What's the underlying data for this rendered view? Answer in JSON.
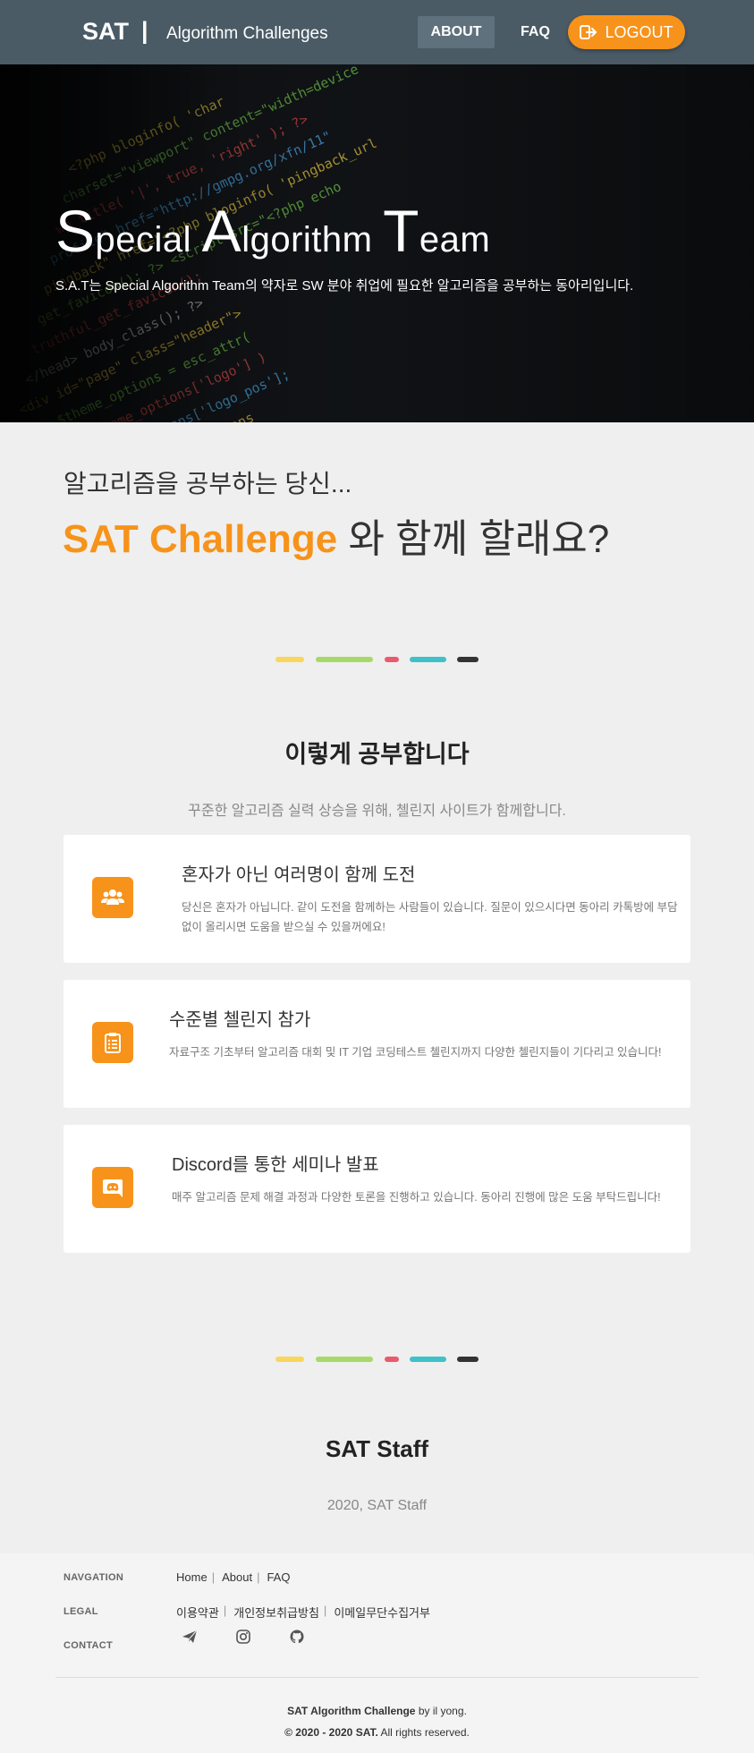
{
  "nav": {
    "brand": "SAT",
    "separator": "|",
    "subtitle": "Algorithm Challenges",
    "about": "ABOUT",
    "faq": "FAQ",
    "logout": "LOGOUT"
  },
  "hero": {
    "title_parts": [
      {
        "cap": "S",
        "rest": "pecial"
      },
      {
        "cap": "A",
        "rest": "lgorithm"
      },
      {
        "cap": "T",
        "rest": "eam"
      }
    ],
    "description": "S.A.T는 Special Algorithm Team의 약자로 SW 분야 취업에 필요한 알고리즘을 공부하는 동아리입니다."
  },
  "intro": {
    "line1": "알고리즘을 공부하는 당신...",
    "accent": "SAT Challenge",
    "line2_rest": " 와 함께 할래요?"
  },
  "divider_colors": [
    "#f9d65c",
    "#a6d96a",
    "#ea5a6f",
    "#3fc1c9",
    "#333333"
  ],
  "study": {
    "title": "이렇게 공부합니다",
    "subtitle": "꾸준한 알고리즘 실력 상승을 위해, 첼린지 사이트가 함께합니다.",
    "cards": [
      {
        "icon": "users-icon",
        "title": "혼자가 아닌 여러명이 함께 도전",
        "text": "당신은 혼자가 아닙니다. 같이 도전을 함께하는 사람들이 있습니다. 질문이 있으시다면 동아리 카톡방에 부담없이 올리시면 도움을 받으실 수 있을꺼에요!"
      },
      {
        "icon": "clipboard-list-icon",
        "title": "수준별 첼린지 참가",
        "text": "자료구조 기초부터 알고리즘 대회 및 IT 기업 코딩테스트 첼린지까지 다양한 첼린지들이 기다리고 있습니다!"
      },
      {
        "icon": "discord-icon",
        "title": "Discord를 통한 세미나 발표",
        "text": "매주 알고리즘 문제 해결 과정과 다양한 토론을 진행하고 있습니다. 동아리 진행에 많은 도움 부탁드립니다!"
      }
    ]
  },
  "staff": {
    "title": "SAT Staff",
    "subtitle": "2020, SAT Staff"
  },
  "footer": {
    "navigation_label": "NAVGATION",
    "navigation_links": [
      "Home",
      "About",
      "FAQ"
    ],
    "legal_label": "LEGAL",
    "legal_links": [
      "이용약관",
      "개인정보취급방침",
      "이메일무단수집거부"
    ],
    "contact_label": "CONTACT",
    "contact_icons": [
      "paper-plane-icon",
      "instagram-icon",
      "github-icon"
    ],
    "credit_bold": "SAT Algorithm Challenge",
    "credit_rest": " by il yong.",
    "copyright_bold": "© 2020 - 2020 SAT.",
    "copyright_rest": " All rights reserved."
  },
  "colors": {
    "nav_bg": "#4a5b66",
    "accent": "#f7931a",
    "page_bg": "#efefef"
  }
}
